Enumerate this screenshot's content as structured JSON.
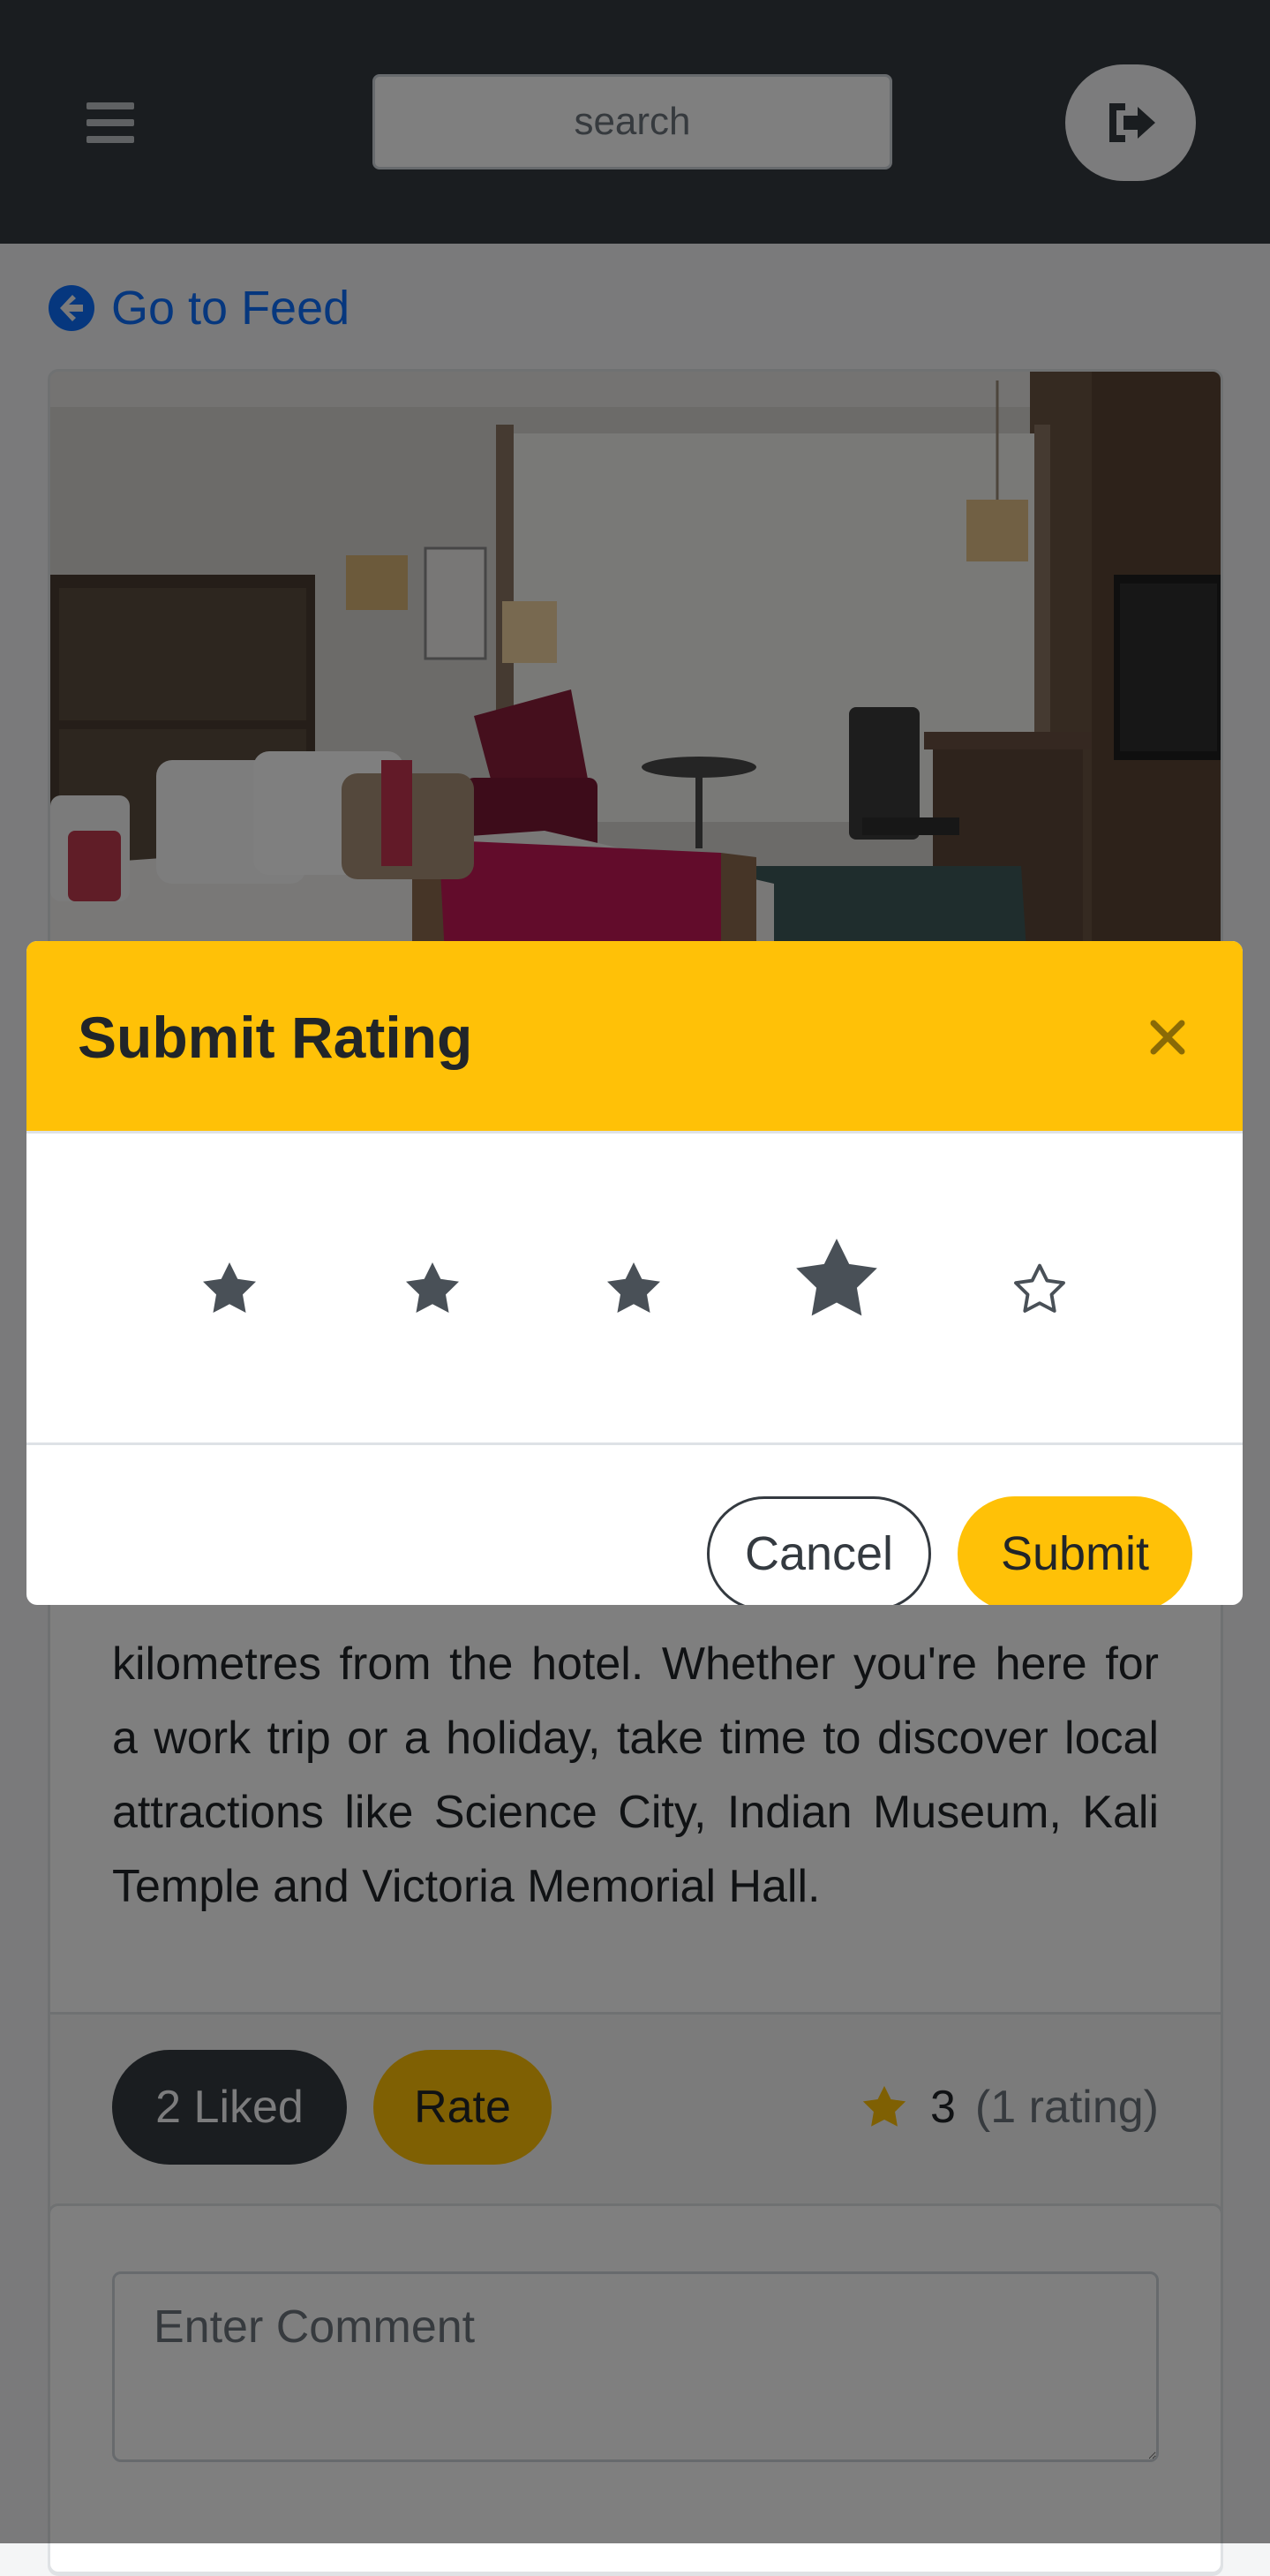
{
  "navbar": {
    "menu_icon": "hamburger-icon",
    "search_placeholder": "search",
    "logout_icon": "sign-out-icon"
  },
  "back_link": {
    "icon": "arrow-circle-left-icon",
    "label": "Go to Feed"
  },
  "post": {
    "image_desc": "hotel-room-photo",
    "description": "kilometres from the hotel. Whether you're here for a work trip or a holiday, take time to discover local attractions like Science City, Indian Museum, Kali Temple and Victoria Memorial Hall.",
    "liked_label": "2 Liked",
    "rate_label": "Rate",
    "rating_value": "3",
    "rating_count": "(1 rating)"
  },
  "comment": {
    "placeholder": "Enter Comment"
  },
  "modal": {
    "title": "Submit Rating",
    "close_icon": "close-icon",
    "stars_total": 5,
    "selected_rating": 4,
    "cancel_label": "Cancel",
    "submit_label": "Submit"
  },
  "colors": {
    "navbar": "#343a40",
    "accent": "#ffc107",
    "link": "#0d6efd",
    "dark_button": "#343a40",
    "star_filled": "#495057"
  }
}
